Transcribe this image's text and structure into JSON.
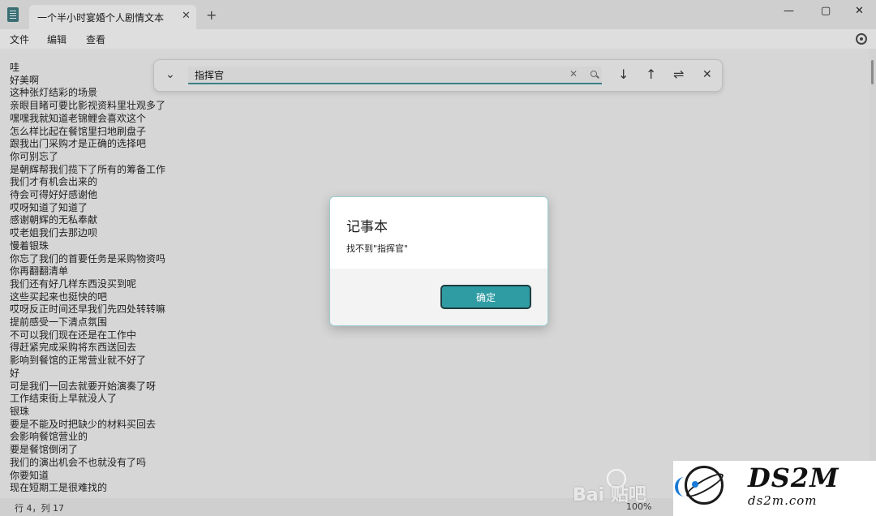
{
  "window": {
    "tab_title": "一个半小时宴婚个人剧情文本",
    "tab_close": "✕",
    "new_tab": "+",
    "minimize": "—",
    "maximize": "▢",
    "close": "✕"
  },
  "menu": {
    "file": "文件",
    "edit": "编辑",
    "view": "查看"
  },
  "editor": {
    "lines": [
      "哇",
      "好美啊",
      "这种张灯结彩的场景",
      "亲眼目睹可要比影视资料里壮观多了",
      "嘿嘿我就知道老锦鲤会喜欢这个",
      "怎么样比起在餐馆里扫地刷盘子",
      "跟我出门采购才是正确的选择吧",
      "你可别忘了",
      "是朝辉帮我们揽下了所有的筹备工作",
      "我们才有机会出来的",
      "待会可得好好感谢他",
      "哎呀知道了知道了",
      "感谢朝辉的无私奉献",
      "哎老姐我们去那边呗",
      "慢着银珠",
      "你忘了我们的首要任务是采购物资吗",
      "你再翻翻清单",
      "我们还有好几样东西没买到呢",
      "这些买起来也挺快的吧",
      "哎呀反正时间还早我们先四处转转嘛",
      "提前感受一下清点氛围",
      "不可以我们现在还是在工作中",
      "得赶紧完成采购将东西送回去",
      "影响到餐馆的正常营业就不好了",
      "好",
      "可是我们一回去就要开始演奏了呀",
      "工作结束街上早就没人了",
      "银珠",
      "要是不能及时把缺少的材料买回去",
      "会影响餐馆营业的",
      "要是餐馆倒闭了",
      "我们的演出机会不也就没有了吗",
      "你要知道",
      "现在短期工是很难找的"
    ]
  },
  "find": {
    "value": "指挥官",
    "clear": "✕",
    "down": "↓",
    "up": "↑",
    "options": "⇌",
    "close": "✕",
    "chevron": "⌄"
  },
  "status": {
    "position": "行 4，列 17",
    "zoom": "100%"
  },
  "dialog": {
    "title": "记事本",
    "message": "找不到\"指挥官\"",
    "ok": "确定"
  },
  "watermarks": {
    "baidu": "Bai 贴吧",
    "logo_main": "DS2M",
    "logo_sub": "ds2m.com"
  },
  "colors": {
    "accent": "#2f9ca3",
    "logo_blue": "#1b7ad6"
  }
}
